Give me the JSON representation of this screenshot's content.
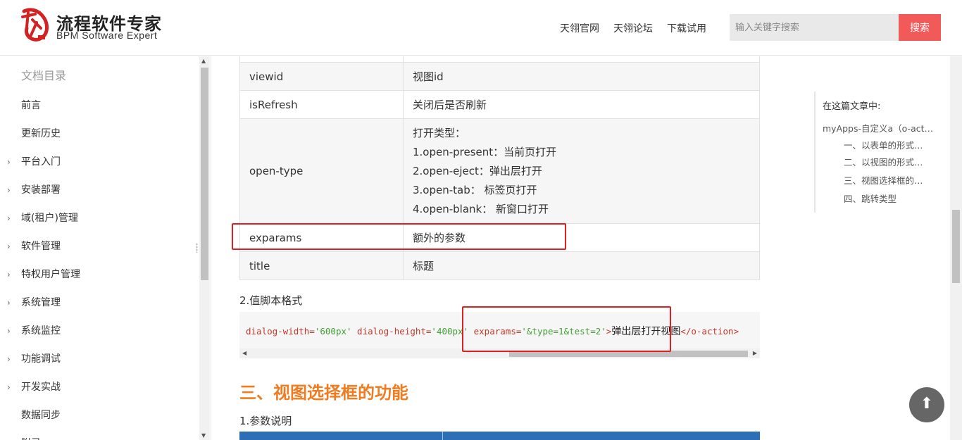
{
  "header": {
    "logo_cn": "流程软件专家",
    "logo_en": "BPM Software Expert",
    "nav": [
      "天翎官网",
      "天翎论坛",
      "下载试用"
    ],
    "search": {
      "placeholder": "输入关键字搜索",
      "button": "搜索"
    }
  },
  "sidebar": {
    "title": "文档目录",
    "items": [
      {
        "label": "前言",
        "expandable": false
      },
      {
        "label": "更新历史",
        "expandable": false
      },
      {
        "label": "平台入门",
        "expandable": true
      },
      {
        "label": "安装部署",
        "expandable": true
      },
      {
        "label": "域(租户)管理",
        "expandable": true
      },
      {
        "label": "软件管理",
        "expandable": true
      },
      {
        "label": "特权用户管理",
        "expandable": true
      },
      {
        "label": "系统管理",
        "expandable": true
      },
      {
        "label": "系统监控",
        "expandable": true
      },
      {
        "label": "功能调试",
        "expandable": true
      },
      {
        "label": "开发实战",
        "expandable": true
      },
      {
        "label": "数据同步",
        "expandable": false
      },
      {
        "label": "附录",
        "expandable": false
      }
    ]
  },
  "content": {
    "params_table": {
      "rows": [
        {
          "key": "viewid",
          "value": "视图id"
        },
        {
          "key": "isRefresh",
          "value": "关闭后是否刷新"
        },
        {
          "key": "open-type",
          "lines": [
            "打开类型：",
            "1.open-present：当前页打开",
            "2.open-eject：弹出层打开",
            "3.open-tab： 标签页打开",
            "4.open-blank： 新窗口打开"
          ]
        },
        {
          "key": "exparams",
          "value": "额外的参数"
        },
        {
          "key": "title",
          "value": "标题"
        }
      ]
    },
    "script_heading": "2.值脚本格式",
    "code": {
      "a1": "dialog-width=",
      "v1": "'600px'",
      "a2": " dialog-height=",
      "v2": "'400px'",
      "a3": " exparams=",
      "v3": "'&type=1&test=2'",
      "t1": ">",
      "text": "弹出层打开视图",
      "t2": "</o-action>"
    },
    "section_title": "三、视图选择框的功能",
    "param_heading": "1.参数说明"
  },
  "outline": {
    "title": "在这篇文章中:",
    "items": [
      "myApps-自定义a（o-action）",
      "一、以表单的形式打开",
      "二、以视图的形式打开",
      "三、视图选择框的功能",
      "四、跳转类型"
    ]
  },
  "back_to_top": "⬆"
}
